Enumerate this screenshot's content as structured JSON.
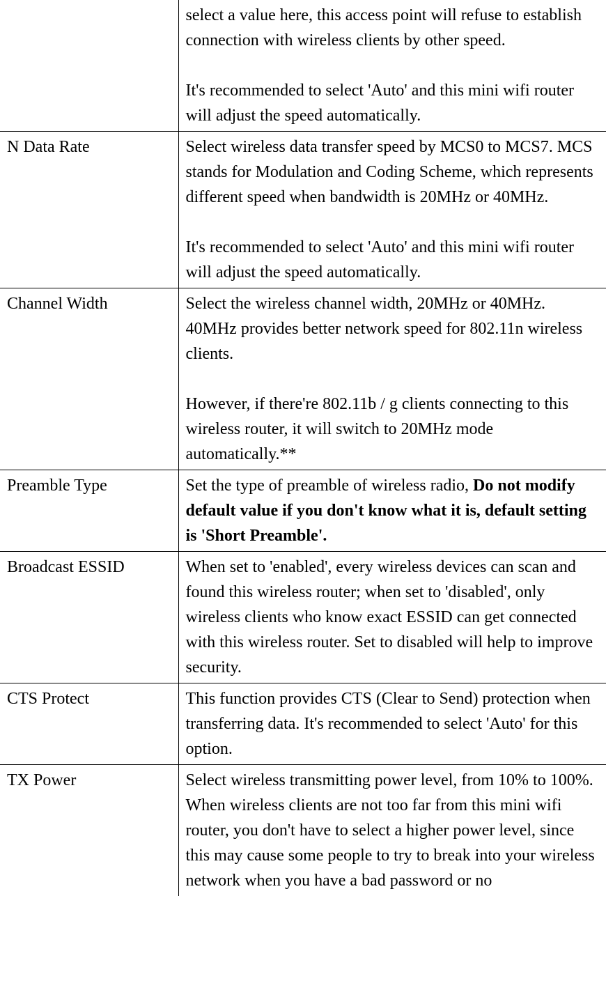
{
  "rows": [
    {
      "label": "",
      "desc_p1": "select a value here, this access point will refuse to establish connection with wireless clients by other speed.",
      "desc_p2": "It's recommended to select 'Auto' and this mini wifi router will adjust the speed automatically."
    },
    {
      "label": "N Data Rate",
      "desc_p1": "Select wireless data transfer speed by MCS0 to MCS7. MCS stands for Modulation and Coding Scheme, which represents different speed when bandwidth is 20MHz or 40MHz.",
      "desc_p2": "It's recommended to select 'Auto' and this mini wifi router will adjust the speed automatically."
    },
    {
      "label": "Channel Width",
      "desc_p1": "Select the wireless channel width, 20MHz or 40MHz. 40MHz provides better network speed for 802.11n wireless clients.",
      "desc_p2": "However, if there're 802.11b / g clients connecting to this wireless router, it will switch to 20MHz mode automatically.**"
    },
    {
      "label": "Preamble Type",
      "desc_plain": "Set the type of preamble of wireless radio, ",
      "desc_bold": "Do not modify default value if you don't know what it is, default setting is 'Short Preamble'."
    },
    {
      "label": "Broadcast ESSID",
      "desc_p1": "When set to 'enabled', every wireless devices can scan and found this wireless router; when set to 'disabled', only wireless clients who know exact ESSID can get connected with this wireless router. Set to disabled will help to improve security."
    },
    {
      "label": "CTS Protect",
      "desc_p1": "This function provides CTS (Clear to Send) protection when transferring data. It's recommended to select 'Auto' for this option."
    },
    {
      "label": "TX Power",
      "desc_p1": "Select wireless transmitting power level, from 10% to 100%. When wireless clients are not too far from this mini wifi router, you don't have to select a higher power level, since this may cause some people to try to break into your wireless network when you have a bad password or no"
    }
  ]
}
